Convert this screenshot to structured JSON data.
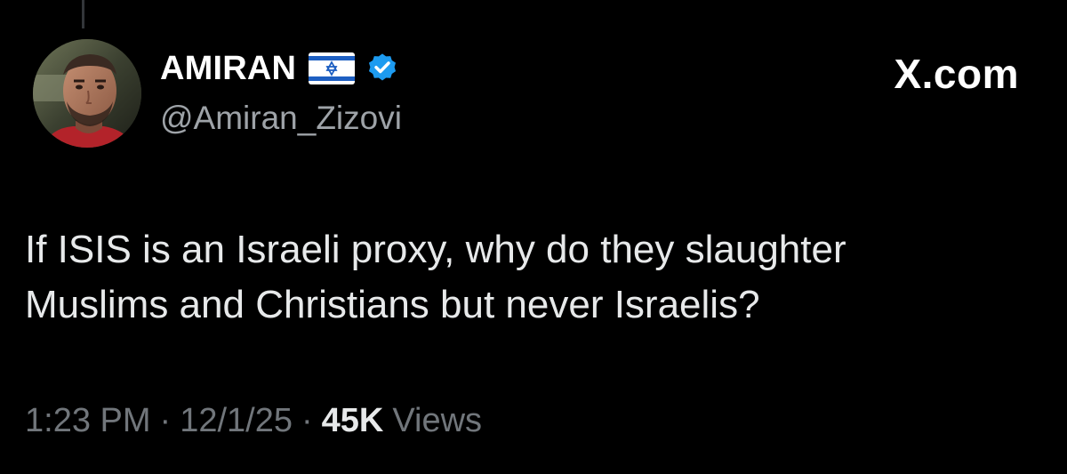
{
  "tweet": {
    "display_name": "AMIRAN",
    "handle": "@Amiran_Zizovi",
    "brand": "X.com",
    "text_lines": [
      "If ISIS is an Israeli proxy, why do they slaughter",
      "Muslims and Christians but never Israelis?"
    ],
    "time": "1:23 PM",
    "date": "12/1/25",
    "separator": "·",
    "views_count": "45K",
    "views_label": "Views"
  },
  "icons": {
    "flag": "israel-flag-icon",
    "verified": "verified-badge-icon"
  },
  "colors": {
    "background": "#000000",
    "name": "#ffffff",
    "body_text": "#e7e9ea",
    "secondary_text": "#71767b",
    "verified_blue": "#1d9bf0"
  }
}
